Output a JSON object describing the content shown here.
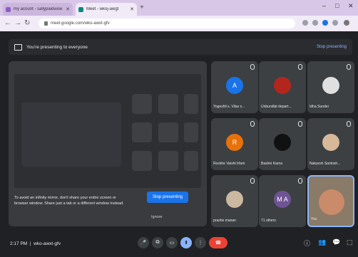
{
  "browser": {
    "tabs": [
      {
        "label": "my acount - sallypaidwise"
      },
      {
        "label": "Meet - wkoj-awgt"
      }
    ],
    "new_tab": "+",
    "address": "meet.google.com/wko-awxt-gfv",
    "window_controls": [
      "–",
      "□",
      "✕"
    ]
  },
  "banner": {
    "text": "You're presenting to everyone",
    "stop": "Stop presenting"
  },
  "presentation": {
    "warning": "To avoid an infinity mirror, don't share your entire screen or browser window. Share just a tab or a different window instead.",
    "stop_button": "Stop presenting",
    "ignore": "Ignore"
  },
  "participants": [
    {
      "name": "Yogeshli s. Vilas s...",
      "initial": "A",
      "color": "#1a73e8"
    },
    {
      "name": "Unbundlat depart...",
      "initial": "",
      "color": "#b3261e"
    },
    {
      "name": "Idha Sunder",
      "initial": "",
      "color": "#e0e0e0"
    },
    {
      "name": "Rockhe Vaishi Irfam",
      "initial": "R",
      "color": "#e8710a"
    },
    {
      "name": "Bashni Karna",
      "initial": "",
      "color": "#111111"
    },
    {
      "name": "Nakyesh Santosh...",
      "initial": "",
      "color": "#d7b899"
    },
    {
      "name": "prashe manan",
      "initial": "",
      "color": "#cbb8a0"
    },
    {
      "name": "71 others",
      "initial": "M A",
      "color": "#6e5494"
    },
    {
      "name": "You",
      "initial": "",
      "color": "#c98b6a"
    }
  ],
  "bottom": {
    "time": "2:17 PM",
    "meeting_code": "wko-awxt-gfv",
    "controls": [
      "🎤",
      "⧉",
      "▭",
      "⬆",
      "⋮",
      "☎"
    ]
  }
}
